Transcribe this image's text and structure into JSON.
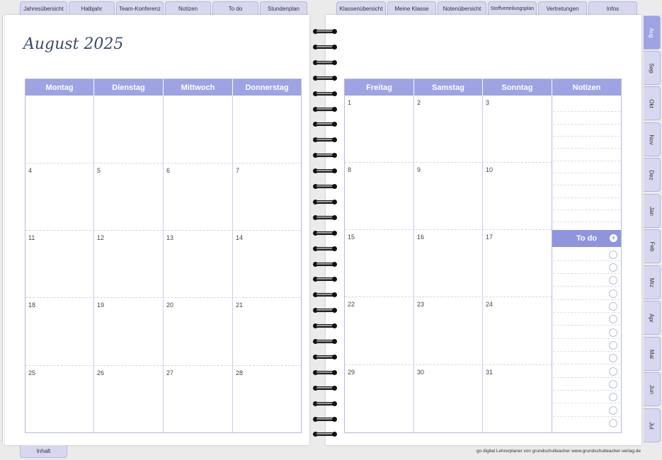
{
  "top_tabs_left": [
    "Jahresübersicht",
    "Halbjahr",
    "Team-Konferenz",
    "Notizen",
    "To do",
    "Stundenplan"
  ],
  "top_tabs_right": [
    "Klassenübersicht",
    "Meine Klasse",
    "Notenübersicht",
    "Stoffverteilungsplan",
    "Vertretungen",
    "Infos"
  ],
  "month_title": "August 2025",
  "left_days": [
    "Montag",
    "Dienstag",
    "Mittwoch",
    "Donnerstag"
  ],
  "right_days": [
    "Freitag",
    "Samstag",
    "Sonntag"
  ],
  "notes_label": "Notizen",
  "todo_label": "To do",
  "todo_plus": "+",
  "left_dates": [
    [
      "",
      "",
      "",
      ""
    ],
    [
      "4",
      "5",
      "6",
      "7"
    ],
    [
      "11",
      "12",
      "13",
      "14"
    ],
    [
      "18",
      "19",
      "20",
      "21"
    ],
    [
      "25",
      "26",
      "27",
      "28"
    ]
  ],
  "right_dates": [
    [
      "1",
      "2",
      "3"
    ],
    [
      "8",
      "9",
      "10"
    ],
    [
      "15",
      "16",
      "17"
    ],
    [
      "22",
      "23",
      "24"
    ],
    [
      "29",
      "30",
      "31"
    ]
  ],
  "side_tabs": [
    "Aug",
    "Sep",
    "Okt",
    "Nov",
    "Dez",
    "Jan",
    "Feb",
    "Mrz",
    "Apr",
    "Mai",
    "Jun",
    "Jul"
  ],
  "active_side_tab": "Aug",
  "bottom_tab": "Inhalt",
  "footer": "go digital Lehrerplaner von grundschulteacher www.grundschulteacher-verlag.de",
  "colors": {
    "header": "#9ea3e3",
    "tab": "#d7d8ef",
    "todo_header": "#8f95dd"
  }
}
